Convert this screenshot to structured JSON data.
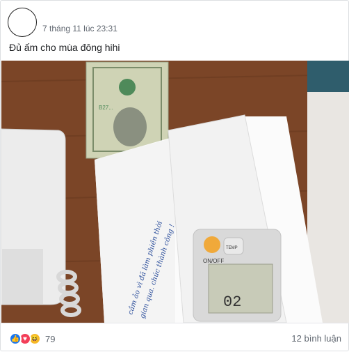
{
  "post": {
    "author_name": "",
    "timestamp": "7 tháng 11 lúc 23:31",
    "text": "Đủ ấm cho mùa đông hihi"
  },
  "photo": {
    "note_handwriting_line1": "cầm ảo vì đã làm phiền thời",
    "note_handwriting_line2": "gian qua. chúc thành công !",
    "remote_display": "02",
    "remote_label": "ON/OFF",
    "remote_button": "TEMP"
  },
  "footer": {
    "reaction_count": "79",
    "reaction_icons": [
      "like-icon",
      "love-icon",
      "haha-icon"
    ],
    "comments_label": "12 bình luận"
  },
  "colors": {
    "link": "#385898",
    "meta": "#606770",
    "like": "#1877f2",
    "love": "#f33e58",
    "haha": "#f7b928"
  }
}
